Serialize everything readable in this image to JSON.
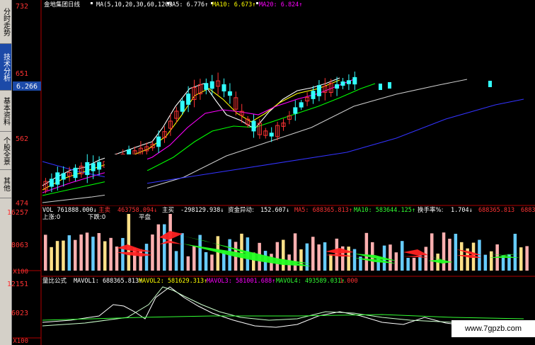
{
  "side_tabs": [
    {
      "label": "分时走势",
      "active": false
    },
    {
      "label": "技术分析",
      "active": true
    },
    {
      "label": "基本资料",
      "active": false
    },
    {
      "label": "个股全景",
      "active": false
    },
    {
      "label": "其他",
      "active": false
    }
  ],
  "price_axis": {
    "top": "732",
    "mid": "651",
    "low": "562",
    "bottom": "474",
    "current_price": "6.266"
  },
  "volume_axis": {
    "top": "16257",
    "mid": "8063",
    "unit": "X100"
  },
  "ratio_axis": {
    "top": "12151",
    "mid": "6023",
    "unit": "X100"
  },
  "main_header": {
    "stock": "金地集团日线",
    "ma_params": "MA(5,10,20,30,60,120)",
    "ma5": "MA5: 6.776↑",
    "ma10": "MA10: 6.673↑",
    "ma20": "MA20: 6.824↑"
  },
  "volume_header": {
    "vol": "VOL 761888.000↓",
    "zhumai": "主卖",
    "zhumai_val": "463758.094↓",
    "zhumai_buy": "主买",
    "zhumai_buy_val": "-298129.938↓",
    "fund_label": "资金异动:",
    "fund_val": "152.607↓",
    "ma5": "MA5: 688365.813↑",
    "ma10": "MA10: 583644.125↑",
    "turnover_label": "换手率%:",
    "turnover_val": "1.704↓",
    "extra": "688365.813",
    "extra2": "6883"
  },
  "volume_sub": {
    "up": "上涨:0",
    "down": "下跌:0",
    "flat": "平盘"
  },
  "ratio_header": {
    "name": "量比公式",
    "mavol1": "MAVOL1: 688365.813↑",
    "mavol2": "MAVOL2: 581629.313↑",
    "mavol3": "MAVOL3: 581001.688↑",
    "mavol4": "MAVOL4: 493589.031↑",
    "ratio": "1.000"
  },
  "watermark": "www.7gpzb.com",
  "colors": {
    "up": "#ff3333",
    "down": "#33ffff",
    "ma5": "#ffffff",
    "ma10": "#ffff00",
    "ma20": "#ff00ff",
    "ma30": "#00ff00",
    "ma60": "#cccccc",
    "ma120": "#3333ff"
  }
}
